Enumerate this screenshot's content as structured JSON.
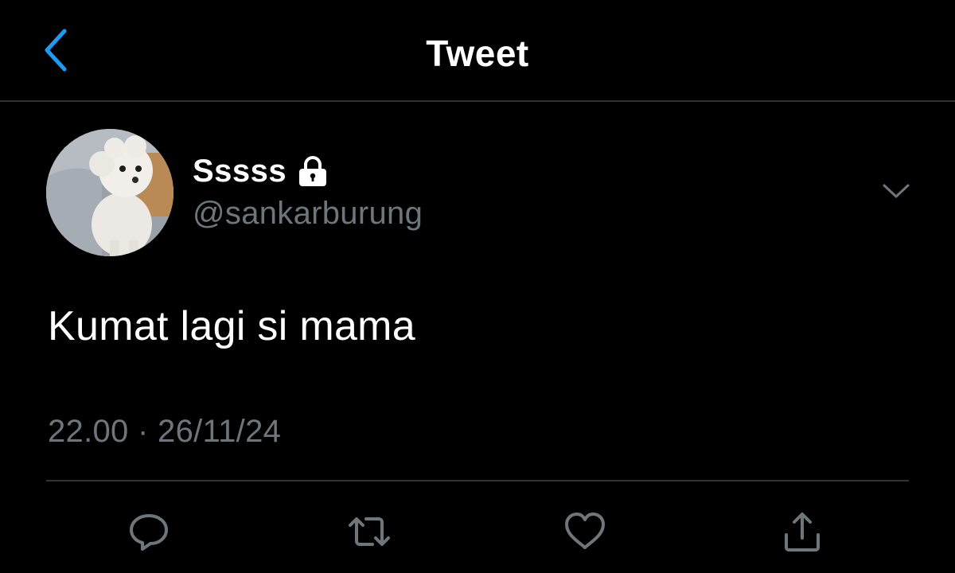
{
  "header": {
    "title": "Tweet",
    "back_icon": "chevron-left-icon",
    "accent_color": "#1d9bf0"
  },
  "tweet": {
    "author": {
      "display_name": "Sssss",
      "handle": "@sankarburung",
      "protected_icon": "lock-icon",
      "avatar": "white poodle photo"
    },
    "menu_icon": "chevron-down-icon",
    "text": "Kumat lagi si mama",
    "timestamp": "22.00 · 26/11/24"
  },
  "actions": [
    {
      "icon": "reply-icon"
    },
    {
      "icon": "retweet-icon"
    },
    {
      "icon": "like-icon"
    },
    {
      "icon": "share-icon"
    }
  ],
  "colors": {
    "background": "#000000",
    "text_primary": "#ffffff",
    "text_secondary": "#6e767d",
    "divider": "#2f3336"
  }
}
